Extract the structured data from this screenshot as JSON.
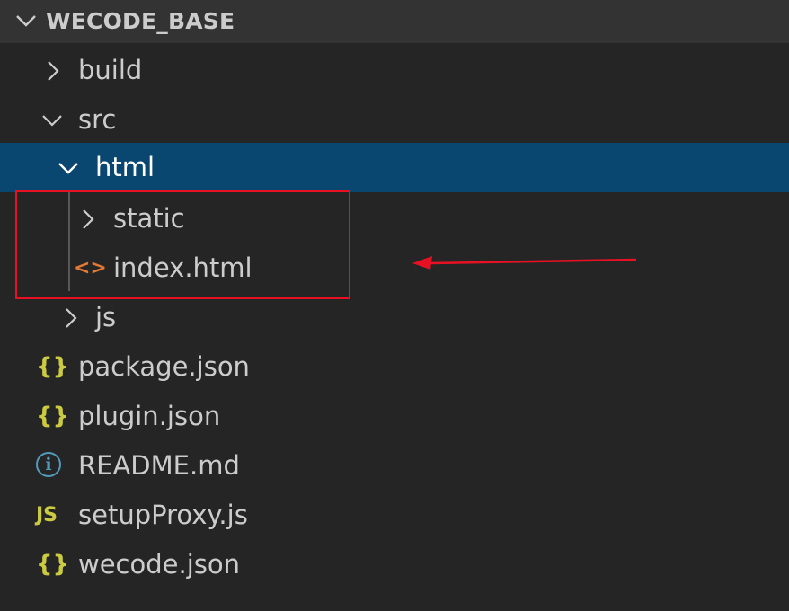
{
  "explorer": {
    "title": "WECODE_BASE",
    "items": [
      {
        "label": "build",
        "type": "folder",
        "expanded": false
      },
      {
        "label": "src",
        "type": "folder",
        "expanded": true
      },
      {
        "label": "html",
        "type": "folder",
        "expanded": true,
        "selected": true
      },
      {
        "label": "static",
        "type": "folder",
        "expanded": false
      },
      {
        "label": "index.html",
        "type": "html-file",
        "icon": "<>"
      },
      {
        "label": "js",
        "type": "folder",
        "expanded": false
      },
      {
        "label": "package.json",
        "type": "json-file",
        "icon": "{}"
      },
      {
        "label": "plugin.json",
        "type": "json-file",
        "icon": "{}"
      },
      {
        "label": "README.md",
        "type": "info-file",
        "icon": "i"
      },
      {
        "label": "setupProxy.js",
        "type": "js-file",
        "icon": "JS"
      },
      {
        "label": "wecode.json",
        "type": "json-file",
        "icon": "{}"
      }
    ]
  },
  "colors": {
    "background": "#252526",
    "header": "#333333",
    "selection": "#094771",
    "annotation": "#e81123",
    "json_icon": "#cbcb41",
    "html_icon": "#e37933",
    "info_icon": "#519aba",
    "js_icon": "#cbcb41"
  }
}
